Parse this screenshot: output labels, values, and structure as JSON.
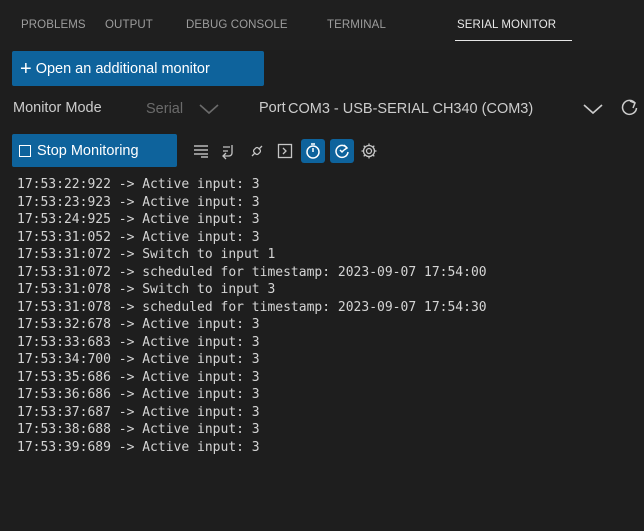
{
  "tabs": [
    {
      "label": "PROBLEMS"
    },
    {
      "label": "OUTPUT"
    },
    {
      "label": "DEBUG CONSOLE"
    },
    {
      "label": "TERMINAL"
    },
    {
      "label": "SERIAL MONITOR",
      "active": true
    }
  ],
  "open_button": {
    "label": "Open an additional monitor",
    "icon": "plus-icon"
  },
  "monitor_mode": {
    "label": "Monitor Mode",
    "value": "Serial"
  },
  "port": {
    "label": "Port",
    "value": "COM3 - USB-SERIAL CH340 (COM3)"
  },
  "toolbar": {
    "stop_label": "Stop Monitoring",
    "icons": [
      "clear-output-icon",
      "toggle-line-ending-icon",
      "connect-icon",
      "terminal-icon",
      "timestamp-toggle-icon",
      "autoscroll-toggle-icon",
      "settings-gear-icon"
    ]
  },
  "colors": {
    "accent": "#0e639c",
    "background": "#1e1e1e",
    "text": "#d4d4d4"
  },
  "log_lines": [
    "17:53:22:922 -> Active input: 3",
    "17:53:23:923 -> Active input: 3",
    "17:53:24:925 -> Active input: 3",
    "17:53:31:052 -> Active input: 3",
    "17:53:31:072 -> Switch to input 1",
    "17:53:31:072 -> scheduled for timestamp: 2023-09-07 17:54:00",
    "17:53:31:078 -> Switch to input 3",
    "17:53:31:078 -> scheduled for timestamp: 2023-09-07 17:54:30",
    "17:53:32:678 -> Active input: 3",
    "17:53:33:683 -> Active input: 3",
    "17:53:34:700 -> Active input: 3",
    "17:53:35:686 -> Active input: 3",
    "17:53:36:686 -> Active input: 3",
    "17:53:37:687 -> Active input: 3",
    "17:53:38:688 -> Active input: 3",
    "17:53:39:689 -> Active input: 3"
  ]
}
